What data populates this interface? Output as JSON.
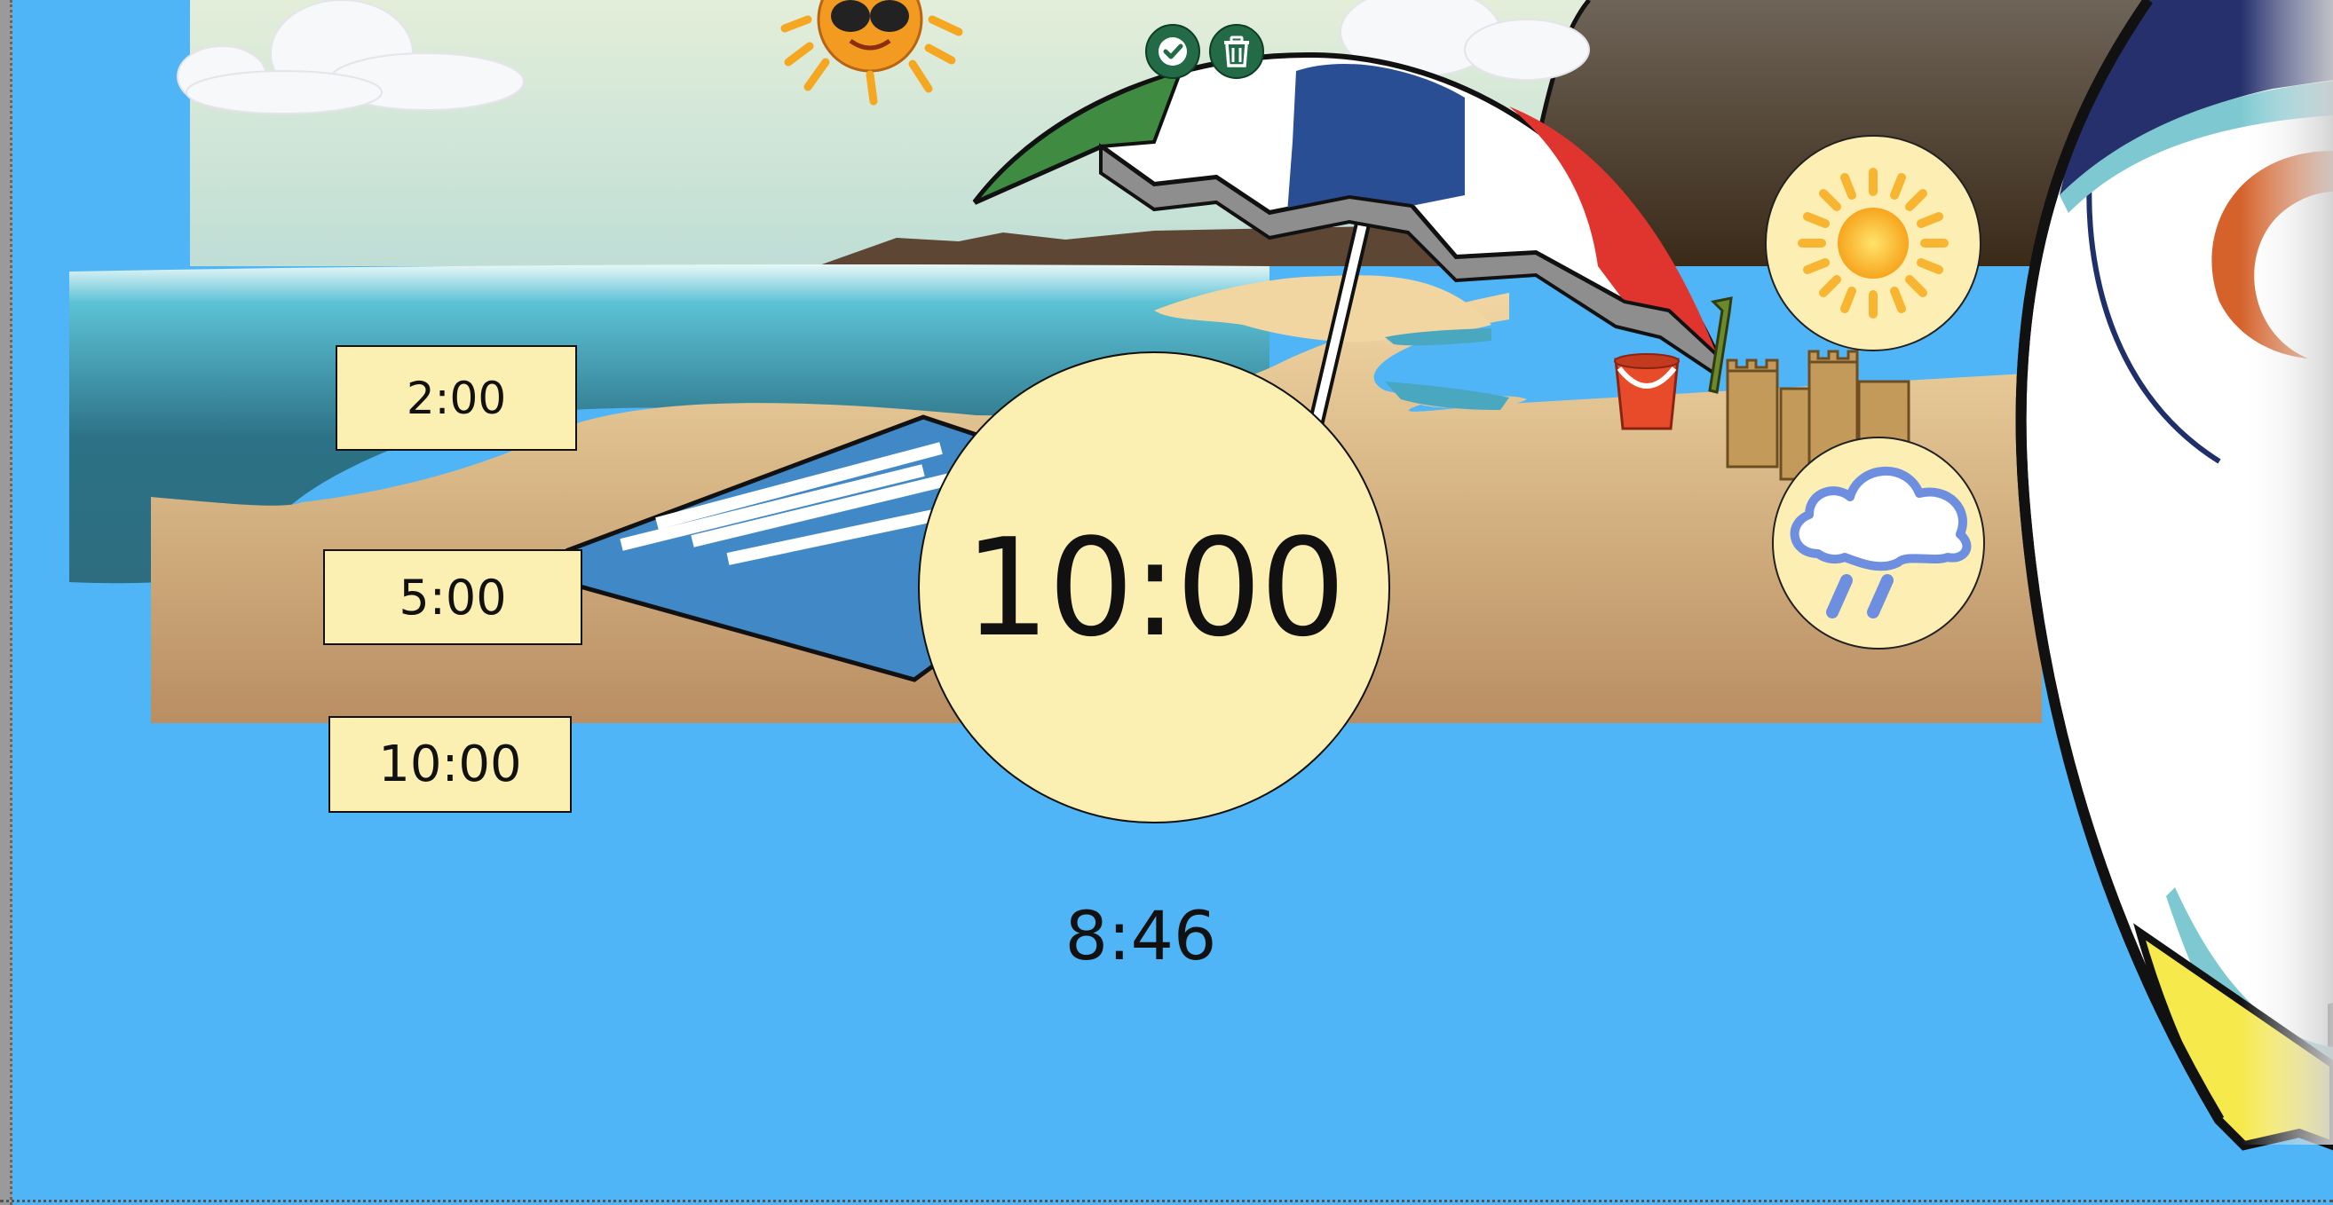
{
  "timer": {
    "presets": [
      {
        "label": "2:00"
      },
      {
        "label": "5:00"
      },
      {
        "label": "10:00"
      }
    ],
    "selected": "10:00",
    "remaining": "8:46"
  },
  "toolbar": {
    "confirm_icon": "checkmark-icon",
    "delete_icon": "trash-icon"
  },
  "weather_buttons": [
    {
      "icon": "sun-icon"
    },
    {
      "icon": "rain-cloud-icon"
    }
  ],
  "colors": {
    "page_background": "#4fb5f6",
    "preset_fill": "#fcefb2",
    "tool_button": "#226b46"
  }
}
